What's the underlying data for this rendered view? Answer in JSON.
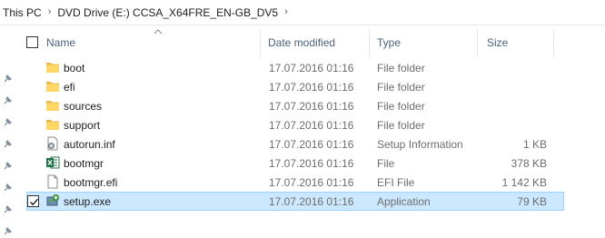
{
  "breadcrumb": {
    "items": [
      {
        "label": "This PC"
      },
      {
        "label": "DVD Drive (E:) CCSA_X64FRE_EN-GB_DV5"
      }
    ]
  },
  "columns": {
    "name": "Name",
    "date_modified": "Date modified",
    "type": "Type",
    "size": "Size"
  },
  "files": [
    {
      "name": "boot",
      "date": "17.07.2016 01:16",
      "type": "File folder",
      "size": "",
      "icon": "folder-icon"
    },
    {
      "name": "efi",
      "date": "17.07.2016 01:16",
      "type": "File folder",
      "size": "",
      "icon": "folder-icon"
    },
    {
      "name": "sources",
      "date": "17.07.2016 01:16",
      "type": "File folder",
      "size": "",
      "icon": "folder-icon"
    },
    {
      "name": "support",
      "date": "17.07.2016 01:16",
      "type": "File folder",
      "size": "",
      "icon": "folder-icon"
    },
    {
      "name": "autorun.inf",
      "date": "17.07.2016 01:16",
      "type": "Setup Information",
      "size": "1 KB",
      "icon": "setup-info-icon"
    },
    {
      "name": "bootmgr",
      "date": "17.07.2016 01:16",
      "type": "File",
      "size": "378 KB",
      "icon": "excel-file-icon"
    },
    {
      "name": "bootmgr.efi",
      "date": "17.07.2016 01:16",
      "type": "EFI File",
      "size": "1 142 KB",
      "icon": "blank-file-icon"
    },
    {
      "name": "setup.exe",
      "date": "17.07.2016 01:16",
      "type": "Application",
      "size": "79 KB",
      "icon": "setup-exe-icon",
      "selected": true
    }
  ],
  "colors": {
    "selection_bg": "#cce8ff",
    "selection_border": "#99d1ff",
    "header_text": "#4c607a",
    "folder": "#ffd766"
  }
}
